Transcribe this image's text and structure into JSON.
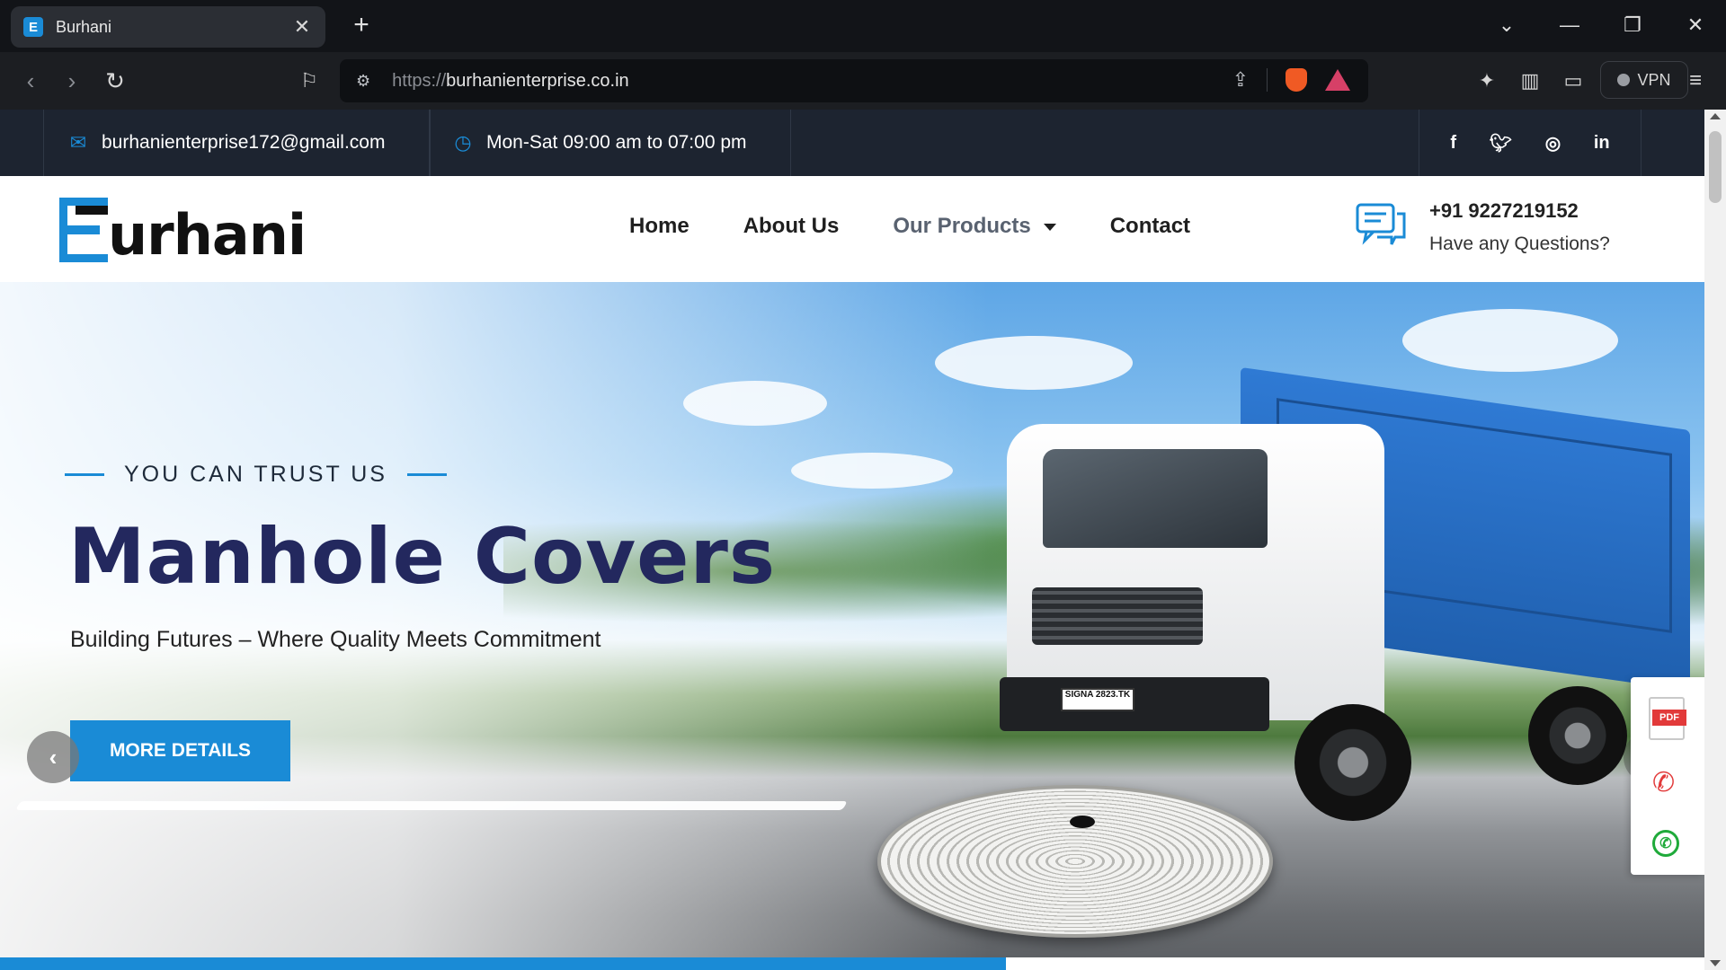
{
  "browser": {
    "tab_title": "Burhani",
    "tab_favicon_letter": "E",
    "url_protocol": "https://",
    "url_host": "burhanienterprise.co.in",
    "vpn_label": "VPN"
  },
  "topbar": {
    "email": "burhanienterprise172@gmail.com",
    "hours": "Mon-Sat 09:00 am to 07:00 pm",
    "social": [
      "f",
      "t",
      "ig",
      "in"
    ]
  },
  "header": {
    "logo_text": "urhani",
    "nav": [
      "Home",
      "About Us",
      "Our Products",
      "Contact"
    ],
    "phone": "+91 9227219152",
    "phone_caption": "Have any Questions?"
  },
  "hero": {
    "eyebrow": "YOU CAN TRUST US",
    "title": "Manhole Covers",
    "subtitle": "Building Futures – Where Quality Meets Commitment",
    "cta_label": "MORE DETAILS",
    "plate_text": "SIGNA 2823.TK",
    "slide_progress": 0.59
  },
  "floating": {
    "pdf_label": "PDF"
  },
  "colors": {
    "accent": "#1a8bd6",
    "title": "#23285e",
    "topbar_bg": "#1d2430"
  }
}
